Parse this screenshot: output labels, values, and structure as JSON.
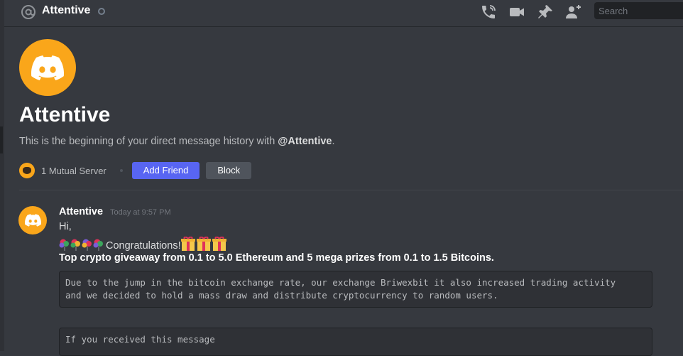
{
  "header": {
    "title": "Attentive",
    "icons": [
      "at-icon",
      "status-idle-icon",
      "phone-call-icon",
      "video-call-icon",
      "pin-icon",
      "add-friend-icon"
    ],
    "search_placeholder": "Search"
  },
  "hero": {
    "name": "Attentive",
    "desc_prefix": "This is the beginning of your direct message history with ",
    "desc_user": "@Attentive",
    "desc_suffix": ".",
    "mutual_servers": "1 Mutual Server",
    "add_friend_label": "Add Friend",
    "block_label": "Block"
  },
  "message": {
    "author": "Attentive",
    "timestamp": "Today at 9:57 PM",
    "line1": "Hi,",
    "line2_text": "Congratulations!",
    "line3": "Top crypto giveaway from 0.1 to 5.0 Ethereum and 5 mega prizes from 0.1 to 1.5 Bitcoins.",
    "code1_line1": "Due to the jump in the bitcoin exchange rate, our exchange Briwexbit it also increased trading activity",
    "code1_line2": "and we decided to hold a mass draw and distribute cryptocurrency to random users.",
    "code2_line1": "If you received this message"
  },
  "colors": {
    "background": "#36393f",
    "avatar": "#faa61a",
    "primary_button": "#5865f2",
    "secondary_button": "#4f545c"
  }
}
